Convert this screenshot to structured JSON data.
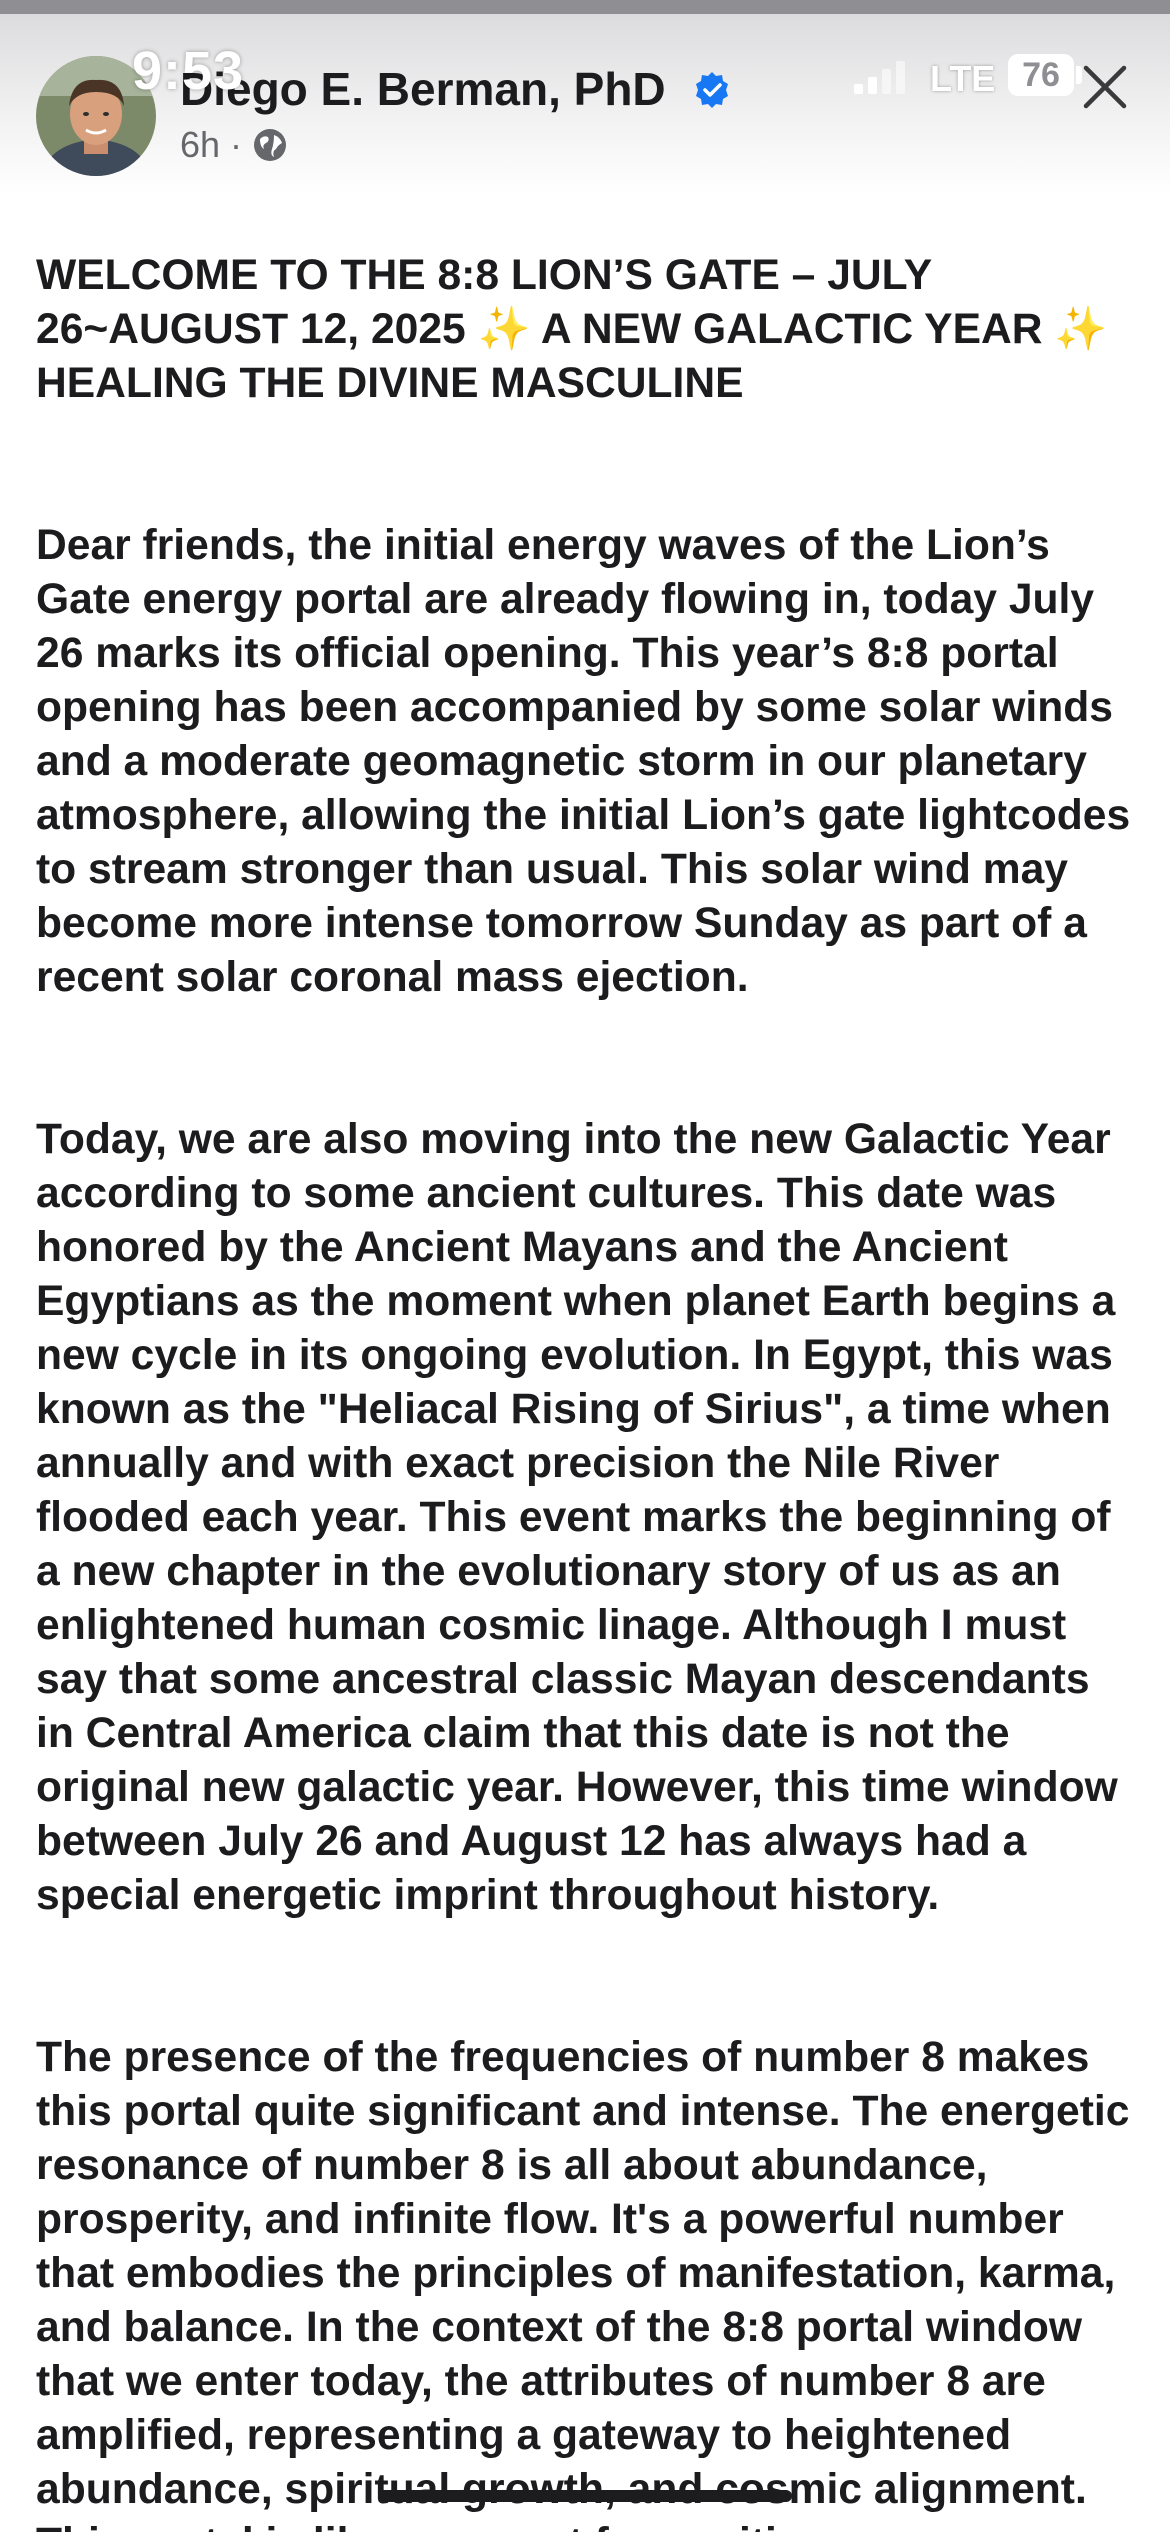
{
  "status_bar": {
    "time": "9:53",
    "network": "LTE",
    "battery": "76"
  },
  "post": {
    "author": "Diego E. Berman, PhD",
    "time_ago": "6h",
    "separator": "·",
    "audience_icon": "globe-icon",
    "verified_icon": "verified-badge-icon",
    "title": "WELCOME TO THE 8:8 LION’S GATE – JULY 26~AUGUST 12, 2025 ✨ A NEW GALACTIC YEAR ✨ HEALING THE DIVINE MASCULINE",
    "paragraphs": [
      "Dear friends, the initial energy waves of the Lion’s Gate energy portal are already flowing in, today July 26 marks its official opening. This year’s 8:8 portal opening has been accompanied by some solar winds and a moderate geomagnetic storm in our planetary atmosphere, allowing the initial Lion’s gate lightcodes to stream stronger than usual. This solar wind may become more intense tomorrow Sunday as part of a recent solar coronal mass ejection.",
      "Today, we are also moving into the new Galactic Year according to some ancient cultures. This date was honored by the Ancient Mayans and the Ancient Egyptians as the moment when planet Earth begins a new cycle in its ongoing evolution. In Egypt, this was known as the \"Heliacal Rising of Sirius\", a time when annually and with exact precision the Nile River flooded each year. This event marks the beginning of a new chapter in the evolutionary story of us as an enlightened human cosmic linage. Although I must say that some ancestral classic Mayan descendants in Central America claim that this date is not the original new galactic year. However, this time window between July 26 and August 12 has always had a special energetic imprint throughout history.",
      "The presence of the frequencies of number 8 makes this portal quite significant and intense. The energetic resonance of number 8 is all about abundance, prosperity, and infinite flow. It's a powerful number that embodies the principles of manifestation, karma, and balance. In the context of the 8:8 portal window that we enter today, the attributes of number 8 are amplified, representing a gateway to heightened abundance, spiritual growth, and cosmic alignment. This portal is like a magnet for positive"
    ]
  },
  "close_icon": "close-icon",
  "colors": {
    "text": "#1c1c1e",
    "meta_text": "#65676b",
    "verified_blue": "#1877f2",
    "background": "#ffffff"
  }
}
